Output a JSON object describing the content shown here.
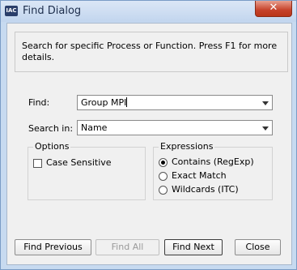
{
  "window": {
    "title": "Find Dialog",
    "app_icon": "IAC",
    "close_glyph": "✕"
  },
  "info": {
    "text": "Search for specific Process or Function. Press F1 for more details."
  },
  "find": {
    "label": "Find:",
    "value": "Group MPI"
  },
  "search_in": {
    "label": "Search in:",
    "value": "Name"
  },
  "options": {
    "title": "Options",
    "case_sensitive_label": "Case Sensitive",
    "case_sensitive_checked": false
  },
  "expressions": {
    "title": "Expressions",
    "items": [
      {
        "label": "Contains (RegExp)",
        "selected": true
      },
      {
        "label": "Exact Match",
        "selected": false
      },
      {
        "label": "Wildcards (ITC)",
        "selected": false
      }
    ]
  },
  "buttons": {
    "find_previous": "Find Previous",
    "find_all": "Find All",
    "find_next": "Find Next",
    "close": "Close"
  }
}
